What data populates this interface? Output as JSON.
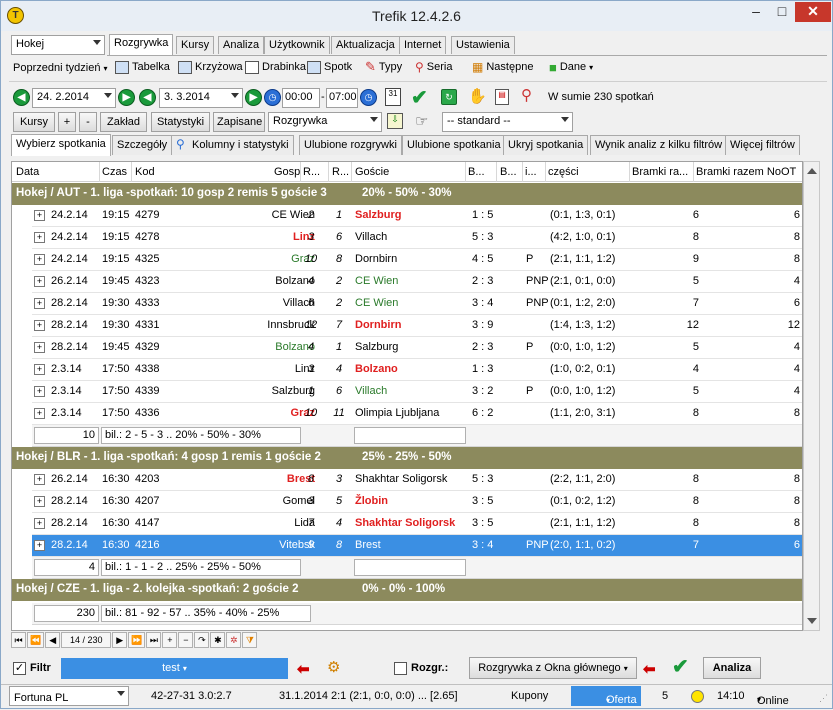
{
  "window": {
    "title": "Trefik 12.4.2.6",
    "min": "–",
    "max": "□",
    "close": "✕"
  },
  "topbar": {
    "sport": "Hokej",
    "period": "Poprzedni tydzień",
    "tabs": [
      "Rozgrywka",
      "Kursy",
      "Analiza",
      "Użytkownik",
      "Aktualizacja",
      "Internet",
      "Ustawienia"
    ],
    "tools": [
      "Tabelka",
      "Krzyżowa",
      "Drabinka",
      "Spotk",
      "Typy",
      "Seria",
      "Następne",
      "Dane"
    ]
  },
  "filters": {
    "date_from": "24. 2.2014",
    "date_to": "3. 3.2014",
    "time_from": "00:00",
    "time_to": "07:00",
    "summary": "W sumie 230 spotkań",
    "buttons": [
      "Kursy",
      "+",
      "-",
      "Zakład",
      "Statystyki",
      "Zapisane"
    ],
    "competition": "Rozgrywka",
    "standard": "-- standard --"
  },
  "subtabs": [
    "Wybierz spotkania",
    "Szczegóły",
    "Kolumny i statystyki",
    "Ulubione rozgrywki",
    "Ulubione spotkania",
    "Ukryj spotkania",
    "Wynik analiz z kilku filtrów",
    "Więcej filtrów"
  ],
  "columns": [
    "Data",
    "Czas",
    "Kod",
    "Gosp",
    "R...",
    "R...",
    "Goście",
    "B...",
    "B...",
    "i...",
    "części",
    "Bramki ra...",
    "Bramki razem NoOT"
  ],
  "groups": [
    {
      "title": "Hokej / AUT - 1. liga -spotkań: 10  gosp 2  remis 5  goście 3",
      "pct": "20% - 50% - 30%",
      "rows": [
        {
          "date": "24.2.14",
          "time": "19:15",
          "code": "4279",
          "home": "CE Wien",
          "hs": "2",
          "as": "1",
          "away": "Salzburg",
          "win": "a",
          "score": "1 : 5",
          "flag": "",
          "parts": "(0:1, 1:3, 0:1)",
          "g": "6",
          "gn": "6"
        },
        {
          "date": "24.2.14",
          "time": "19:15",
          "code": "4278",
          "home": "Linz",
          "hs": "3",
          "as": "6",
          "away": "Villach",
          "win": "h",
          "score": "5 : 3",
          "flag": "",
          "parts": "(4:2, 1:0, 0:1)",
          "g": "8",
          "gn": "8"
        },
        {
          "date": "24.2.14",
          "time": "19:15",
          "code": "4325",
          "home": "Graz",
          "hs": "10",
          "as": "8",
          "away": "Dornbirn",
          "win": "hg",
          "score": "4 : 5",
          "flag": "P",
          "parts": "(2:1, 1:1, 1:2)",
          "g": "9",
          "gn": "8"
        },
        {
          "date": "26.2.14",
          "time": "19:45",
          "code": "4323",
          "home": "Bolzano",
          "hs": "4",
          "as": "2",
          "away": "CE Wien",
          "win": "ag",
          "score": "2 : 3",
          "flag": "PNP",
          "parts": "(2:1, 0:1, 0:0)",
          "g": "5",
          "gn": "4"
        },
        {
          "date": "28.2.14",
          "time": "19:30",
          "code": "4333",
          "home": "Villach",
          "hs": "6",
          "as": "2",
          "away": "CE Wien",
          "win": "ag",
          "score": "3 : 4",
          "flag": "PNP",
          "parts": "(0:1, 1:2, 2:0)",
          "g": "7",
          "gn": "6"
        },
        {
          "date": "28.2.14",
          "time": "19:30",
          "code": "4331",
          "home": "Innsbruck",
          "hs": "12",
          "as": "7",
          "away": "Dornbirn",
          "win": "a",
          "score": "3 : 9",
          "flag": "",
          "parts": "(1:4, 1:3, 1:2)",
          "g": "12",
          "gn": "12"
        },
        {
          "date": "28.2.14",
          "time": "19:45",
          "code": "4329",
          "home": "Bolzano",
          "hs": "4",
          "as": "1",
          "away": "Salzburg",
          "win": "hg",
          "score": "2 : 3",
          "flag": "P",
          "parts": "(0:0, 1:0, 1:2)",
          "g": "5",
          "gn": "4"
        },
        {
          "date": "2.3.14",
          "time": "17:50",
          "code": "4338",
          "home": "Linz",
          "hs": "3",
          "as": "4",
          "away": "Bolzano",
          "win": "a",
          "score": "1 : 3",
          "flag": "",
          "parts": "(1:0, 0:2, 0:1)",
          "g": "4",
          "gn": "4"
        },
        {
          "date": "2.3.14",
          "time": "17:50",
          "code": "4339",
          "home": "Salzburg",
          "hs": "1",
          "as": "6",
          "away": "Villach",
          "win": "ag",
          "score": "3 : 2",
          "flag": "P",
          "parts": "(0:0, 1:0, 1:2)",
          "g": "5",
          "gn": "4"
        },
        {
          "date": "2.3.14",
          "time": "17:50",
          "code": "4336",
          "home": "Graz",
          "hs": "10",
          "as": "11",
          "away": "Olimpia Ljubljana",
          "win": "h",
          "score": "6 : 2",
          "flag": "",
          "parts": "(1:1, 2:0, 3:1)",
          "g": "8",
          "gn": "8"
        }
      ],
      "sum_count": "10",
      "sum_text": "bil.: 2 - 5 - 3 .. 20% - 50% - 30%"
    },
    {
      "title": "Hokej / BLR - 1. liga -spotkań: 4  gosp 1  remis 1  goście 2",
      "pct": "25% - 25% - 50%",
      "rows": [
        {
          "date": "26.2.14",
          "time": "16:30",
          "code": "4203",
          "home": "Brest",
          "hs": "8",
          "as": "3",
          "away": "Shakhtar Soligorsk",
          "win": "h",
          "score": "5 : 3",
          "flag": "",
          "parts": "(2:2, 1:1, 2:0)",
          "g": "8",
          "gn": "8"
        },
        {
          "date": "28.2.14",
          "time": "16:30",
          "code": "4207",
          "home": "Gomel",
          "hs": "3",
          "as": "5",
          "away": "Žlobin",
          "win": "a",
          "score": "3 : 5",
          "flag": "",
          "parts": "(0:1, 0:2, 1:2)",
          "g": "8",
          "gn": "8"
        },
        {
          "date": "28.2.14",
          "time": "16:30",
          "code": "4147",
          "home": "Lida",
          "hs": "7",
          "as": "4",
          "away": "Shakhtar Soligorsk",
          "win": "a",
          "score": "3 : 5",
          "flag": "",
          "parts": "(2:1, 1:1, 1:2)",
          "g": "8",
          "gn": "8"
        },
        {
          "date": "28.2.14",
          "time": "16:30",
          "code": "4216",
          "home": "Vitebsk",
          "hs": "9",
          "as": "8",
          "away": "Brest",
          "win": "",
          "score": "3 : 4",
          "flag": "PNP",
          "parts": "(2:0, 1:1, 0:2)",
          "g": "7",
          "gn": "6",
          "selected": true
        }
      ],
      "sum_count": "4",
      "sum_text": "bil.: 1 - 1 - 2 .. 25% - 25% - 50%"
    },
    {
      "title": "Hokej / CZE - 1. liga - 2. kolejka -spotkań: 2     goście 2",
      "pct": "0% - 0% - 100%",
      "rows": [],
      "sum_count": "",
      "sum_text": ""
    }
  ],
  "total": {
    "count": "230",
    "text": "bil.: 81 - 92 - 57 .. 35% - 40% - 25%"
  },
  "nav": {
    "position": "14 / 230"
  },
  "bottom": {
    "filter_label": "Filtr",
    "filter_value": "test",
    "rozgr_label": "Rozgr.:",
    "rozgr_value": "Rozgrywka z Okna głównego",
    "analiza": "Analiza"
  },
  "statusbar": {
    "bookmaker": "Fortuna PL",
    "record": "42-27-31  3.0:2.7",
    "last": "31.1.2014 2:1 (2:1, 0:0, 0:0) ... [2.65]",
    "kupony": "Kupony",
    "oferta": "Oferta",
    "count": "5",
    "time": "14:10",
    "online": "Online"
  }
}
